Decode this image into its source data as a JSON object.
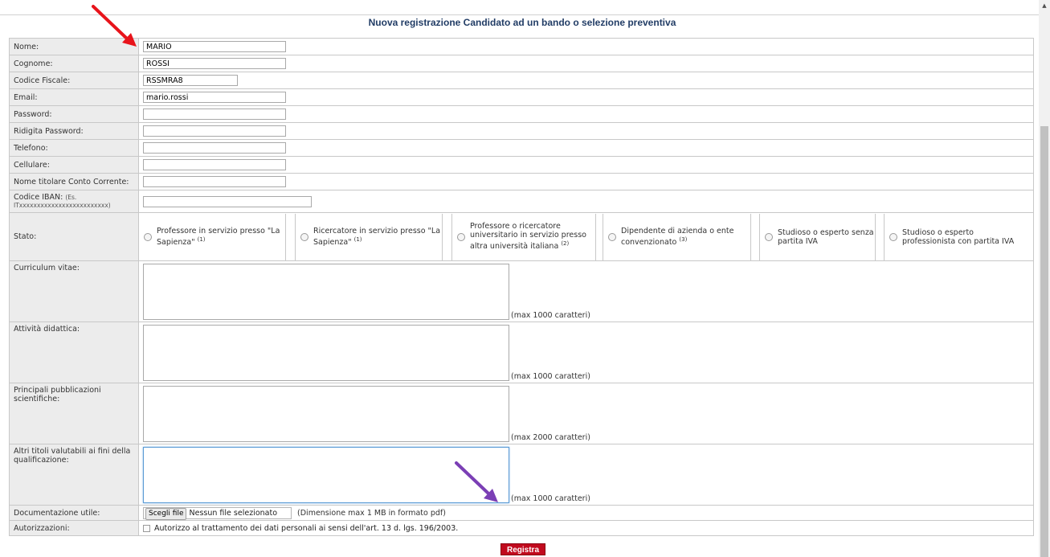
{
  "page": {
    "title": "Nuova registrazione Candidato ad un bando o selezione preventiva"
  },
  "fields": {
    "nome": {
      "label": "Nome:",
      "value": "MARIO"
    },
    "cognome": {
      "label": "Cognome:",
      "value": "ROSSI"
    },
    "codice_fiscale": {
      "label": "Codice Fiscale:",
      "value": "RSSMRA8"
    },
    "email": {
      "label": "Email:",
      "value": "mario.rossi"
    },
    "password": {
      "label": "Password:",
      "value": ""
    },
    "ridigita_password": {
      "label": "Ridigita Password:",
      "value": ""
    },
    "telefono": {
      "label": "Telefono:",
      "value": ""
    },
    "cellulare": {
      "label": "Cellulare:",
      "value": ""
    },
    "titolare": {
      "label": "Nome titolare Conto Corrente:",
      "value": ""
    },
    "iban": {
      "label": "Codice IBAN:",
      "hint": "(Es. ITxxxxxxxxxxxxxxxxxxxxxxxxx)",
      "value": ""
    }
  },
  "stato": {
    "label": "Stato:",
    "options": [
      {
        "text": "Professore in servizio presso \"La Sapienza\"",
        "sup": "(1)"
      },
      {
        "text": "Ricercatore in servizio presso \"La Sapienza\"",
        "sup": "(1)"
      },
      {
        "text": "Professore o ricercatore universitario in servizio presso altra università italiana",
        "sup": "(2)"
      },
      {
        "text": "Dipendente di azienda o ente convenzionato",
        "sup": "(3)"
      },
      {
        "text": "Studioso o esperto senza partita IVA",
        "sup": ""
      },
      {
        "text": "Studioso o esperto professionista con partita IVA",
        "sup": ""
      }
    ]
  },
  "textareas": {
    "curriculum": {
      "label": "Curriculum vitae:",
      "note": "(max 1000 caratteri)"
    },
    "didattica": {
      "label": "Attività didattica:",
      "note": "(max 1000 caratteri)"
    },
    "pubblicazioni": {
      "label": "Principali pubblicazioni scientifiche:",
      "note": "(max 2000 caratteri)"
    },
    "altri_titoli": {
      "label": "Altri titoli valutabili ai fini della qualificazione:",
      "note": "(max 1000 caratteri)"
    }
  },
  "documentazione": {
    "label": "Documentazione utile:",
    "button": "Scegli file",
    "status": "Nessun file selezionato",
    "info": "(Dimensione max 1 MB in formato pdf)"
  },
  "autorizzazioni": {
    "label": "Autorizzazioni:",
    "text": "Autorizzo al trattamento dei dati personali ai sensi dell'art. 13 d. lgs. 196/2003."
  },
  "submit": {
    "label": "Registra"
  },
  "colors": {
    "title": "#223d66",
    "label_bg": "#ececec",
    "submit_bg": "#c10a1e",
    "arrow_red": "#e8141b",
    "arrow_purple": "#7b3fb5"
  }
}
